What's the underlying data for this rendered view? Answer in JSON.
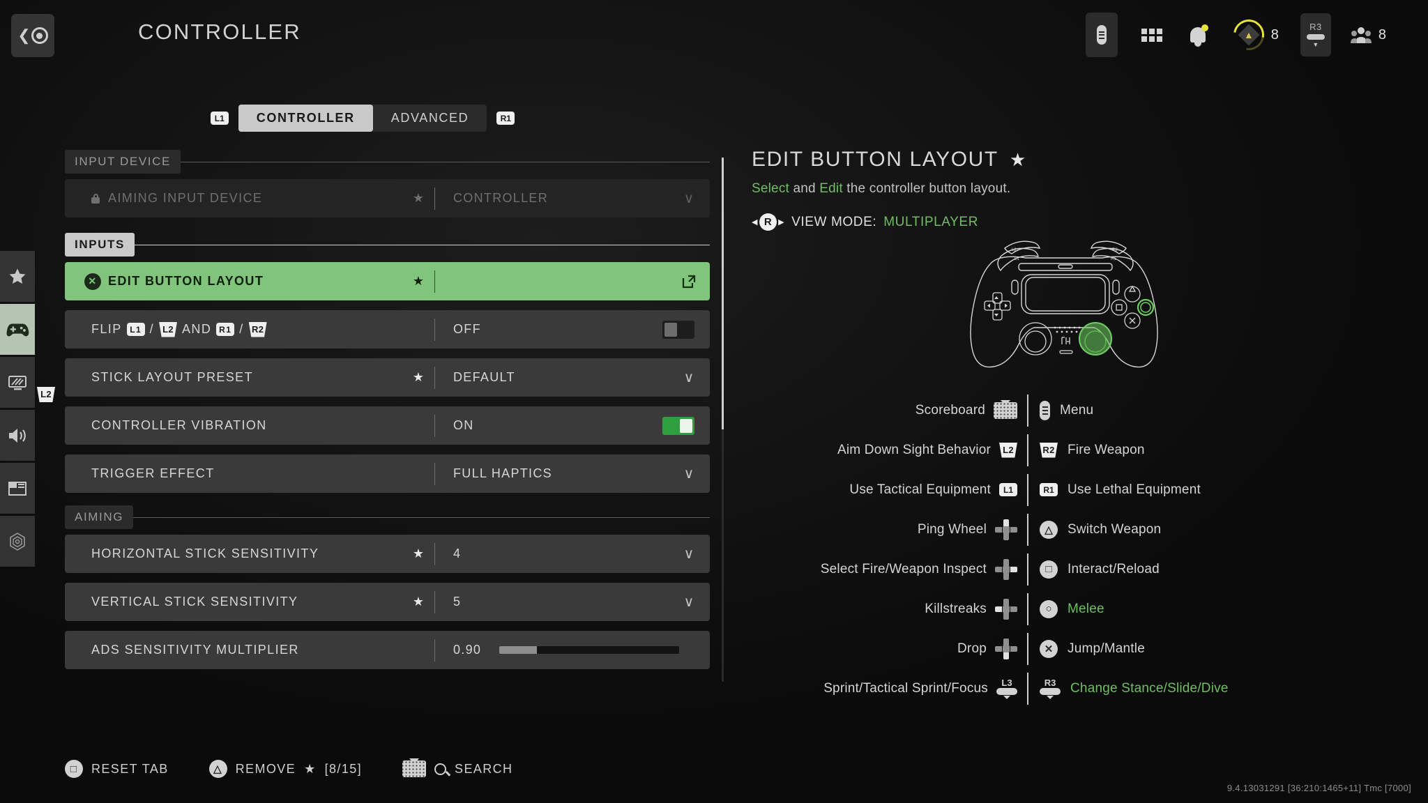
{
  "header": {
    "title": "CONTROLLER",
    "back_icon": "back-circle-icon",
    "rank_count": "8",
    "squad_count": "8",
    "r3_label": "R3"
  },
  "tabs": {
    "left_bumper": "L1",
    "right_bumper": "R1",
    "items": [
      {
        "label": "CONTROLLER",
        "active": true
      },
      {
        "label": "ADVANCED",
        "active": false
      }
    ]
  },
  "sidebar": {
    "trigger_badge": "L2",
    "items": [
      {
        "name": "favorites",
        "icon": "star-icon"
      },
      {
        "name": "controller",
        "icon": "gamepad-icon"
      },
      {
        "name": "graphics",
        "icon": "monitor-icon"
      },
      {
        "name": "audio",
        "icon": "speaker-icon"
      },
      {
        "name": "interface",
        "icon": "layout-icon"
      },
      {
        "name": "accessibility",
        "icon": "accessibility-icon"
      }
    ]
  },
  "settings": {
    "sections": [
      {
        "label": "INPUT DEVICE",
        "style": "dim"
      },
      {
        "label": "INPUTS",
        "style": "bright"
      },
      {
        "label": "AIMING",
        "style": "dim"
      }
    ],
    "rows": {
      "aiming_input_device": {
        "label": "AIMING INPUT DEVICE",
        "value": "CONTROLLER",
        "star": "★"
      },
      "edit_button_layout": {
        "label": "EDIT BUTTON LAYOUT",
        "star": "★",
        "button": "✕"
      },
      "flip": {
        "prefix": "FLIP",
        "b1": "L1",
        "sep1": "/",
        "b2": "L2",
        "mid": "AND",
        "b3": "R1",
        "sep2": "/",
        "b4": "R2",
        "value": "OFF"
      },
      "stick_layout_preset": {
        "label": "STICK LAYOUT PRESET",
        "value": "DEFAULT",
        "star": "★"
      },
      "controller_vibration": {
        "label": "CONTROLLER VIBRATION",
        "value": "ON"
      },
      "trigger_effect": {
        "label": "TRIGGER EFFECT",
        "value": "FULL HAPTICS"
      },
      "horizontal_sensitivity": {
        "label": "HORIZONTAL STICK SENSITIVITY",
        "value": "4",
        "star": "★"
      },
      "vertical_sensitivity": {
        "label": "VERTICAL STICK SENSITIVITY",
        "value": "5",
        "star": "★"
      },
      "ads_multiplier": {
        "label": "ADS SENSITIVITY MULTIPLIER",
        "value": "0.90",
        "fill_percent": 21
      }
    }
  },
  "detail": {
    "title": "EDIT BUTTON LAYOUT",
    "title_star": "★",
    "desc_select": "Select",
    "desc_and": " and ",
    "desc_edit": "Edit",
    "desc_rest": " the controller button layout.",
    "view_mode_button": "R",
    "view_mode_label": "VIEW MODE:",
    "view_mode_value": "MULTIPLAYER",
    "bindings": [
      {
        "left_label": "Scoreboard",
        "left_icon": "touchpad-icon",
        "right_icon": "options-menu-icon",
        "right_label": "Menu",
        "right_green": false
      },
      {
        "left_label": "Aim Down Sight Behavior",
        "left_icon": "l2-trigger-icon",
        "right_icon": "r2-trigger-icon",
        "right_label": "Fire Weapon",
        "right_green": false
      },
      {
        "left_label": "Use Tactical Equipment",
        "left_icon": "l1-bumper-icon",
        "right_icon": "r1-bumper-icon",
        "right_label": "Use Lethal Equipment",
        "right_green": false
      },
      {
        "left_label": "Ping Wheel",
        "left_icon": "dpad-up-icon",
        "right_icon": "triangle-button-icon",
        "right_label": "Switch Weapon",
        "right_green": false
      },
      {
        "left_label": "Select Fire/Weapon Inspect",
        "left_icon": "dpad-right-icon",
        "right_icon": "square-button-icon",
        "right_label": "Interact/Reload",
        "right_green": false
      },
      {
        "left_label": "Killstreaks",
        "left_icon": "dpad-left-icon",
        "right_icon": "circle-button-icon",
        "right_label": "Melee",
        "right_green": true
      },
      {
        "left_label": "Drop",
        "left_icon": "dpad-down-icon",
        "right_icon": "cross-button-icon",
        "right_label": "Jump/Mantle",
        "right_green": false
      },
      {
        "left_label": "Sprint/Tactical Sprint/Focus",
        "left_icon": "l3-stick-icon",
        "right_icon": "r3-stick-icon",
        "right_label": "Change Stance/Slide/Dive",
        "right_green": true
      }
    ],
    "stick_labels": {
      "l3": "L3",
      "r3": "R3"
    }
  },
  "bottom": {
    "reset_tab": "RESET TAB",
    "remove": "REMOVE",
    "remove_star": "★",
    "remove_count": "[8/15]",
    "search": "SEARCH"
  },
  "version": "9.4.13031291 [36:210:1465+11] Tmc [7000]",
  "colors": {
    "accent_green": "#81c57c",
    "text_green": "#6fbf62",
    "toggle_on": "#2f9e3f",
    "rank_yellow": "#e8e23c"
  }
}
